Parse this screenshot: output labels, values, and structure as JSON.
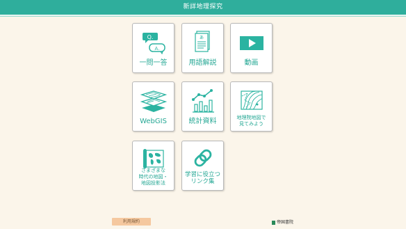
{
  "header": {
    "title": "新詳地理探究"
  },
  "tiles": [
    {
      "label": "一問一答",
      "icon": "qa-bubbles-icon"
    },
    {
      "label": "用語解説",
      "icon": "document-icon"
    },
    {
      "label": "動画",
      "icon": "video-play-icon"
    },
    {
      "label": "WebGIS",
      "icon": "map-layers-icon"
    },
    {
      "label": "統計資料",
      "icon": "statistics-chart-icon"
    },
    {
      "label": "地理院地図で\n見てみよう",
      "icon": "topographic-map-icon"
    },
    {
      "label": "さまざまな\n時代の地図・\n地図投影法",
      "icon": "old-map-icon"
    },
    {
      "label": "学習に役立つ\nリンク集",
      "icon": "link-icon"
    }
  ],
  "footer": {
    "terms_label": "利用規約",
    "publisher": "帝国書院"
  },
  "colors": {
    "accent": "#2fae9c",
    "icon": "#2bb3a1",
    "background": "#fbf5ea",
    "terms_button": "#f5c89f"
  }
}
